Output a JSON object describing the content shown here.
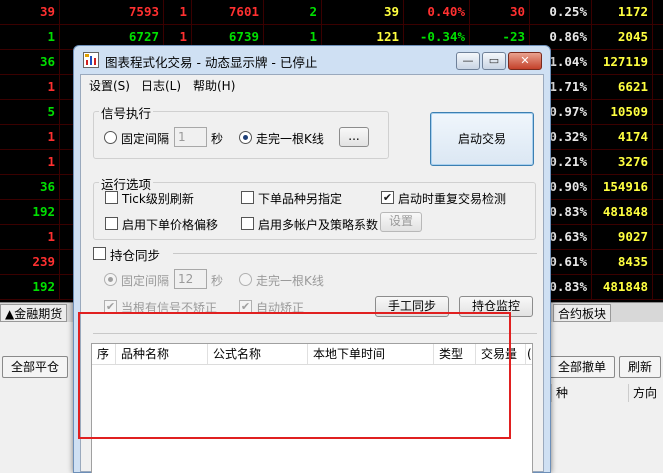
{
  "quote_rows": [
    [
      {
        "v": "39",
        "c": "red"
      },
      {
        "v": "7593",
        "c": "red"
      },
      {
        "v": "1",
        "c": "red"
      },
      {
        "v": "7601",
        "c": "red"
      },
      {
        "v": "2",
        "c": "green"
      },
      {
        "v": "39",
        "c": "yellow"
      },
      {
        "v": "0.40%",
        "c": "red"
      },
      {
        "v": "30",
        "c": "red"
      },
      {
        "v": "0.25%",
        "c": "white"
      },
      {
        "v": "1172",
        "c": "yellow"
      }
    ],
    [
      {
        "v": "1",
        "c": "green"
      },
      {
        "v": "6727",
        "c": "green"
      },
      {
        "v": "1",
        "c": "red"
      },
      {
        "v": "6739",
        "c": "green"
      },
      {
        "v": "1",
        "c": "green"
      },
      {
        "v": "121",
        "c": "yellow"
      },
      {
        "v": "-0.34%",
        "c": "green"
      },
      {
        "v": "-23",
        "c": "green"
      },
      {
        "v": "0.86%",
        "c": "white"
      },
      {
        "v": "2045",
        "c": "yellow"
      }
    ],
    [
      {
        "v": "36",
        "c": "green"
      },
      {
        "v": "",
        "c": "white"
      },
      {
        "v": "",
        "c": "white"
      },
      {
        "v": "",
        "c": "white"
      },
      {
        "v": "",
        "c": "white"
      },
      {
        "v": "",
        "c": "white"
      },
      {
        "v": "",
        "c": "white"
      },
      {
        "v": "",
        "c": "white"
      },
      {
        "v": "1.04%",
        "c": "white"
      },
      {
        "v": "127119",
        "c": "yellow"
      }
    ],
    [
      {
        "v": "1",
        "c": "red"
      },
      {
        "v": "",
        "c": "white"
      },
      {
        "v": "",
        "c": "white"
      },
      {
        "v": "",
        "c": "white"
      },
      {
        "v": "",
        "c": "white"
      },
      {
        "v": "",
        "c": "white"
      },
      {
        "v": "",
        "c": "white"
      },
      {
        "v": "",
        "c": "white"
      },
      {
        "v": "1.71%",
        "c": "white"
      },
      {
        "v": "6621",
        "c": "yellow"
      }
    ],
    [
      {
        "v": "5",
        "c": "green"
      },
      {
        "v": "",
        "c": "white"
      },
      {
        "v": "",
        "c": "white"
      },
      {
        "v": "",
        "c": "white"
      },
      {
        "v": "",
        "c": "white"
      },
      {
        "v": "",
        "c": "white"
      },
      {
        "v": "",
        "c": "white"
      },
      {
        "v": "",
        "c": "white"
      },
      {
        "v": "0.97%",
        "c": "white"
      },
      {
        "v": "10509",
        "c": "yellow"
      }
    ],
    [
      {
        "v": "1",
        "c": "red"
      },
      {
        "v": "",
        "c": "white"
      },
      {
        "v": "",
        "c": "white"
      },
      {
        "v": "",
        "c": "white"
      },
      {
        "v": "",
        "c": "white"
      },
      {
        "v": "",
        "c": "white"
      },
      {
        "v": "",
        "c": "white"
      },
      {
        "v": "",
        "c": "white"
      },
      {
        "v": "0.32%",
        "c": "white"
      },
      {
        "v": "4174",
        "c": "yellow"
      }
    ],
    [
      {
        "v": "1",
        "c": "red"
      },
      {
        "v": "",
        "c": "white"
      },
      {
        "v": "",
        "c": "white"
      },
      {
        "v": "",
        "c": "white"
      },
      {
        "v": "",
        "c": "white"
      },
      {
        "v": "",
        "c": "white"
      },
      {
        "v": "",
        "c": "white"
      },
      {
        "v": "",
        "c": "white"
      },
      {
        "v": "0.21%",
        "c": "white"
      },
      {
        "v": "3276",
        "c": "yellow"
      }
    ],
    [
      {
        "v": "36",
        "c": "green"
      },
      {
        "v": "",
        "c": "white"
      },
      {
        "v": "",
        "c": "white"
      },
      {
        "v": "",
        "c": "white"
      },
      {
        "v": "",
        "c": "white"
      },
      {
        "v": "",
        "c": "white"
      },
      {
        "v": "",
        "c": "white"
      },
      {
        "v": "",
        "c": "white"
      },
      {
        "v": "0.90%",
        "c": "white"
      },
      {
        "v": "154916",
        "c": "yellow"
      }
    ],
    [
      {
        "v": "192",
        "c": "green"
      },
      {
        "v": "",
        "c": "white"
      },
      {
        "v": "",
        "c": "white"
      },
      {
        "v": "",
        "c": "white"
      },
      {
        "v": "",
        "c": "white"
      },
      {
        "v": "",
        "c": "white"
      },
      {
        "v": "",
        "c": "white"
      },
      {
        "v": "",
        "c": "white"
      },
      {
        "v": "0.83%",
        "c": "white"
      },
      {
        "v": "481848",
        "c": "yellow"
      }
    ],
    [
      {
        "v": "1",
        "c": "red"
      },
      {
        "v": "",
        "c": "white"
      },
      {
        "v": "",
        "c": "white"
      },
      {
        "v": "",
        "c": "white"
      },
      {
        "v": "",
        "c": "white"
      },
      {
        "v": "",
        "c": "white"
      },
      {
        "v": "",
        "c": "white"
      },
      {
        "v": "",
        "c": "white"
      },
      {
        "v": "0.63%",
        "c": "white"
      },
      {
        "v": "9027",
        "c": "yellow"
      }
    ],
    [
      {
        "v": "239",
        "c": "red"
      },
      {
        "v": "",
        "c": "white"
      },
      {
        "v": "",
        "c": "white"
      },
      {
        "v": "",
        "c": "white"
      },
      {
        "v": "",
        "c": "white"
      },
      {
        "v": "",
        "c": "white"
      },
      {
        "v": "",
        "c": "white"
      },
      {
        "v": "",
        "c": "white"
      },
      {
        "v": "0.61%",
        "c": "white"
      },
      {
        "v": "8435",
        "c": "yellow"
      }
    ],
    [
      {
        "v": "192",
        "c": "green"
      },
      {
        "v": "",
        "c": "white"
      },
      {
        "v": "",
        "c": "white"
      },
      {
        "v": "",
        "c": "white"
      },
      {
        "v": "",
        "c": "white"
      },
      {
        "v": "",
        "c": "white"
      },
      {
        "v": "",
        "c": "white"
      },
      {
        "v": "",
        "c": "white"
      },
      {
        "v": "0.83%",
        "c": "white"
      },
      {
        "v": "481848",
        "c": "yellow"
      }
    ]
  ],
  "colors": {
    "red": "#ff3030",
    "green": "#00e000",
    "yellow": "#ffff40",
    "white": "#e8e8e8"
  },
  "tabs": {
    "left": "▲金融期货",
    "right": "合约板块"
  },
  "lower": {
    "close_all": "全部平仓",
    "cancel_all": "全部撤单",
    "refresh": "刷新",
    "col_partial": "种",
    "col_direction": "方向"
  },
  "dialog": {
    "title": "图表程式化交易 - 动态显示牌 - 已停止",
    "menu": {
      "settings": "设置(S)",
      "log": "日志(L)",
      "help": "帮助(H)"
    },
    "signal": {
      "title": "信号执行",
      "fixed_interval": "固定间隔",
      "interval_value": "1",
      "seconds": "秒",
      "per_bar": "走完一根K线",
      "more": "...",
      "selected": "per_bar"
    },
    "start_button": "启动交易",
    "options": {
      "title": "运行选项",
      "tick_refresh": "Tick级别刷新",
      "order_other_contract": "下单品种另指定",
      "recheck_on_start": "启动时重复交易检测",
      "price_offset": "启用下单价格偏移",
      "multi_account": "启用多帐户及策略系数",
      "setup": "设置",
      "tick_refresh_checked": false,
      "order_other_contract_checked": false,
      "recheck_on_start_checked": true,
      "price_offset_checked": false,
      "multi_account_checked": false
    },
    "position_sync": {
      "title": "持仓同步",
      "enabled": false,
      "fixed_interval": "固定间隔",
      "interval_value": "12",
      "seconds": "秒",
      "per_bar": "走完一根K线",
      "no_correct_on_signal": "当根有信号不矫正",
      "auto_correct": "自动矫正",
      "manual_sync": "手工同步",
      "position_monitor": "持仓监控"
    },
    "table": {
      "columns": [
        "序",
        "品种名称",
        "公式名称",
        "本地下单时间",
        "类型",
        "交易量",
        "("
      ]
    }
  }
}
